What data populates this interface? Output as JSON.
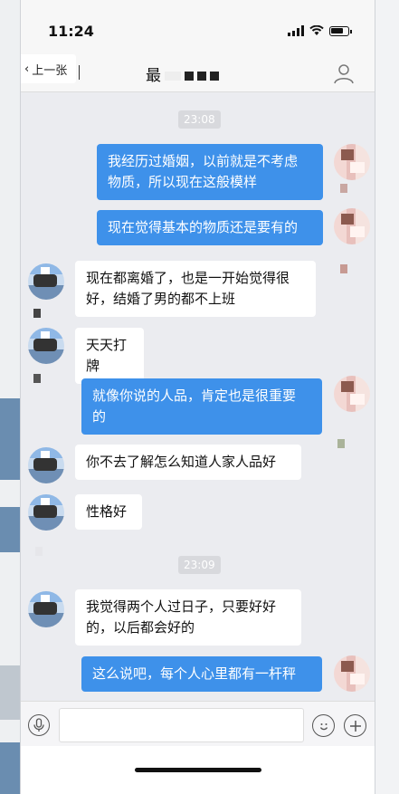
{
  "status_bar": {
    "time": "11:24"
  },
  "nav": {
    "back_label": "上一张",
    "title_visible": "最"
  },
  "messages": [
    {
      "type": "timestamp",
      "text": "23:08"
    },
    {
      "type": "sent",
      "lines": [
        "我经历过婚姻，以前就是不考虑",
        "物质，所以现在这般模样"
      ]
    },
    {
      "type": "sent",
      "lines": [
        "现在觉得基本的物质还是要有的"
      ]
    },
    {
      "type": "received",
      "lines": [
        "现在都离婚了，也是一开始觉得很",
        "好，结婚了男的都不上班"
      ]
    },
    {
      "type": "received",
      "lines": [
        "天天打牌"
      ]
    },
    {
      "type": "sent",
      "lines": [
        "就像你说的人品，肯定也是很重要",
        "的"
      ]
    },
    {
      "type": "received",
      "lines": [
        "你不去了解怎么知道人家人品好"
      ]
    },
    {
      "type": "received",
      "lines": [
        "性格好"
      ]
    },
    {
      "type": "timestamp",
      "text": "23:09"
    },
    {
      "type": "received",
      "lines": [
        "我觉得两个人过日子，只要好好",
        "的，以后都会好的"
      ]
    },
    {
      "type": "sent",
      "lines": [
        "这么说吧，每个人心里都有一杆秤"
      ]
    }
  ],
  "input": {
    "placeholder": ""
  },
  "icons": {
    "back": "chevron-left-icon",
    "profile": "person-icon",
    "mic": "microphone-icon",
    "emoji": "smiley-icon",
    "plus": "plus-icon"
  },
  "colors": {
    "sent_bubble": "#3e91ea",
    "received_bubble": "#ffffff",
    "chat_bg": "#ebecf0"
  }
}
